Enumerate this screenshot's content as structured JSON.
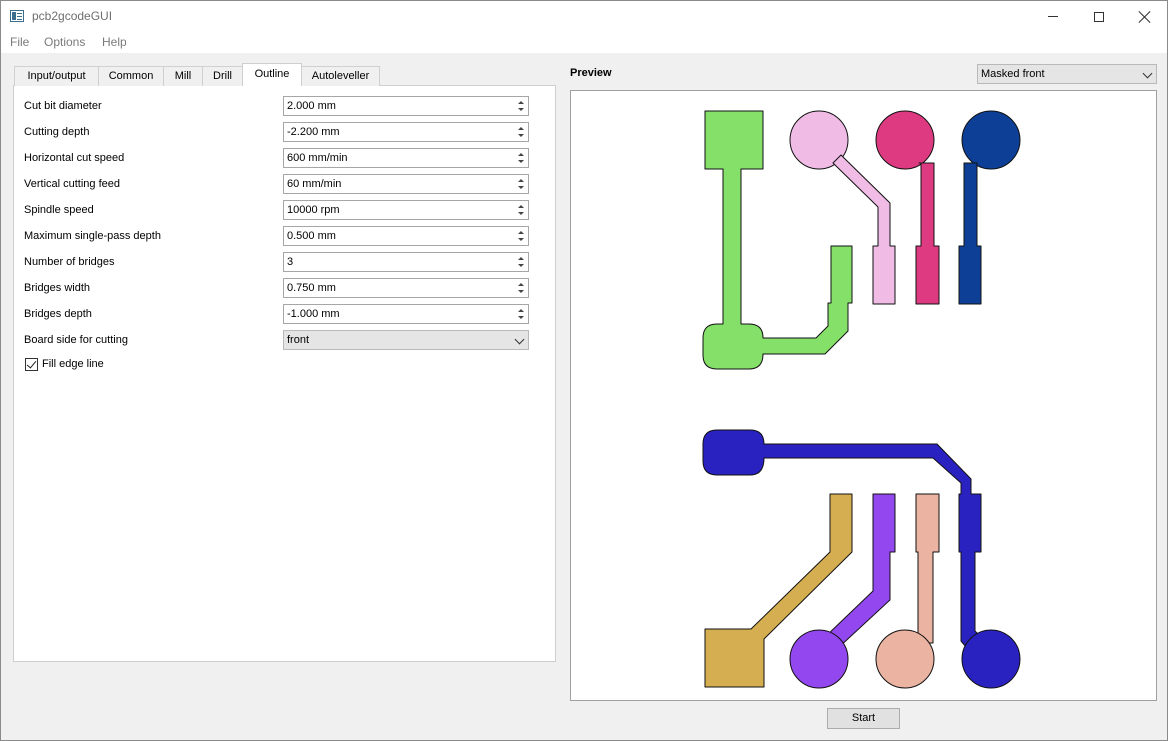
{
  "window": {
    "title": "pcb2gcodeGUI"
  },
  "menu": [
    "File",
    "Options",
    "Help"
  ],
  "tabs": [
    "Input/output",
    "Common",
    "Mill",
    "Drill",
    "Outline",
    "Autoleveller"
  ],
  "active_tab": "Outline",
  "fields": [
    {
      "label": "Cut bit diameter",
      "value": "2.000 mm"
    },
    {
      "label": "Cutting depth",
      "value": "-2.200 mm"
    },
    {
      "label": "Horizontal cut speed",
      "value": "600 mm/min"
    },
    {
      "label": "Vertical cutting feed",
      "value": "60 mm/min"
    },
    {
      "label": "Spindle speed",
      "value": "10000 rpm"
    },
    {
      "label": "Maximum single-pass depth",
      "value": "0.500 mm"
    },
    {
      "label": "Number of bridges",
      "value": "3"
    },
    {
      "label": "Bridges width",
      "value": "0.750 mm"
    },
    {
      "label": "Bridges depth",
      "value": "-1.000 mm"
    }
  ],
  "board_side": {
    "label": "Board side for cutting",
    "value": "front"
  },
  "fill_edge": {
    "label": "Fill edge line",
    "checked": true
  },
  "preview": {
    "label": "Preview",
    "mode": "Masked front"
  },
  "start_label": "Start",
  "trace_colors": {
    "green": "#85e06a",
    "pink": "#f0bce6",
    "magenta": "#dd3a82",
    "navy": "#0d3f96",
    "blue": "#2a22c0",
    "gold": "#d4ae50",
    "purple": "#9247ef",
    "salmon": "#ebb3a2"
  }
}
